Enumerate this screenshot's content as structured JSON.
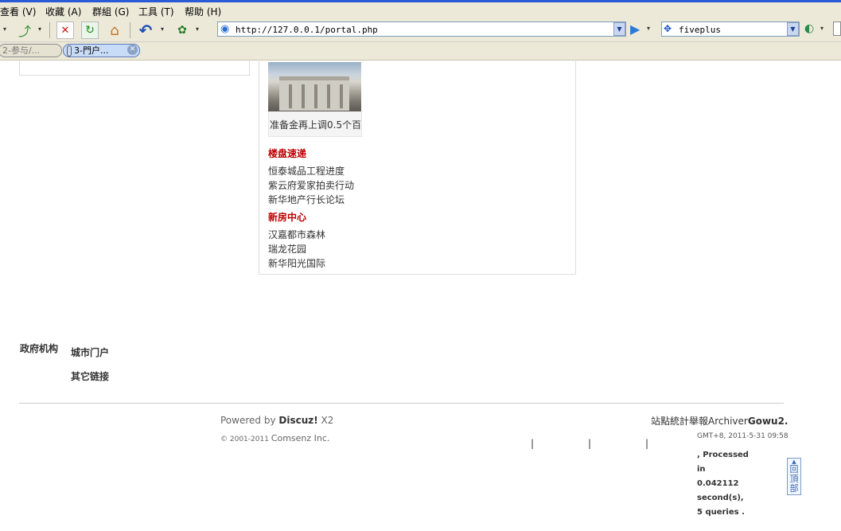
{
  "menubar": {
    "items": [
      "查看 (V)",
      "收藏 (A)",
      "群組 (G)",
      "工具 (T)",
      "帮助 (H)"
    ]
  },
  "toolbar": {
    "address": "http://127.0.0.1/portal.php",
    "search_engine_text": "fiveplus"
  },
  "tabs": [
    {
      "label": "2-参与/..."
    },
    {
      "label": "3-門户..."
    }
  ],
  "content": {
    "photo_caption": "准备金再上调0.5个百",
    "section1": {
      "title": "楼盘速递",
      "links": [
        "恒泰城品工程进度",
        "紫云府爱家拍卖行动",
        "新华地产行长论坛"
      ]
    },
    "section2": {
      "title": "新房中心",
      "links": [
        "汉嘉都市森林",
        "瑞龙花园",
        "新华阳光国际"
      ]
    }
  },
  "footer": {
    "label_gov": "政府机构",
    "label_portal": "城市门户",
    "label_other": "其它链接",
    "powered_prefix": "Powered by ",
    "powered_brand": "Discuz!",
    "powered_version": " X2",
    "copyright": "© 2001-2011 ",
    "company": "Comsenz Inc.",
    "right_links": "站點統計舉報Archiver",
    "site_name": "Gowu2.",
    "time": "GMT+8, 2011-5-31 09:58",
    "processed_lines": [
      ", Processed",
      "in",
      "0.042112",
      "second(s),",
      "5 queries ."
    ],
    "back_to_top": "回頂部"
  }
}
